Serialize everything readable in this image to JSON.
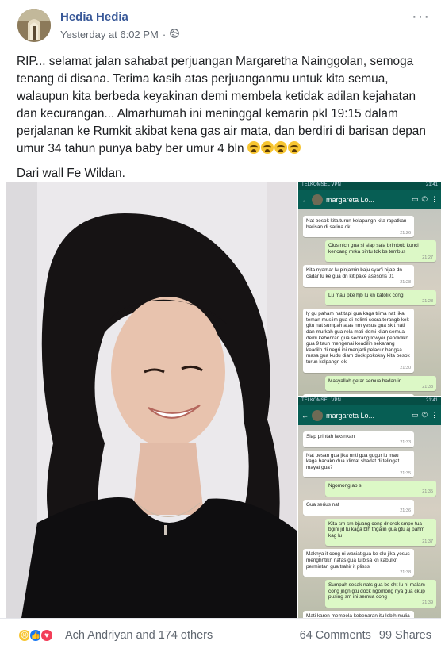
{
  "post": {
    "author": "Hedia Hedia",
    "timestamp": "Yesterday at 6:02 PM",
    "separator": "·",
    "privacy_icon": "globe-icon",
    "more_label": "···",
    "paragraph1": "RIP... selamat jalan sahabat perjuangan Margaretha Nainggolan, semoga tenang di disana. Terima kasih atas perjuanganmu untuk kita semua, walaupun kita berbeda keyakinan demi membela ketidak adilan kejahatan dan kecurangan... Almarhumah ini meninggal kemarin pkl 19:15 dalam perjalanan ke Rumkit akibat kena gas air mata, dan berdiri di barisan depan umur 34 tahun punya baby ber umur 4 bln",
    "emoji_count": 4,
    "paragraph2": "Dari wall Fe Wildan."
  },
  "chat1": {
    "status_left": "TELKOMSEL VPN",
    "status_right": "21:41",
    "contact": "margareta Lo...",
    "messages": [
      {
        "dir": "in",
        "text": "Nat besok kita turun kelapangn kita rapatkan barisan di sarina ok",
        "time": "21:26"
      },
      {
        "dir": "out",
        "text": "Cius nich gua si siap saja brimbob kunci kencang mrka pintu tdk bs tembus",
        "time": "21:27"
      },
      {
        "dir": "in",
        "text": "Kita nyamar lu pinjamin baju syar'i hijab dn cadar lu ke gua dn kit pake asesoris 01",
        "time": "21:28"
      },
      {
        "dir": "out",
        "text": "Lu mau pke hjb lu kn katolik cong",
        "time": "21:28"
      },
      {
        "dir": "in",
        "text": "ly gu paham nat tapi gua kaga trima nat jika teman muslim gua di zolimi secra terangb kek gitu nat sumpah atas nm yesus gua skit hati dan murkah gua rela mati demi klian semua demi kebenran gua seorang lowyer pendidikn gua 9 taun mengenai keadilin sekarang keadiln di negri ini menjadi pelacur bangsa masa gua kudu diam dock pokokny kita besok turun kelpangn ok",
        "time": "21:30"
      },
      {
        "dir": "out",
        "text": "Masyallah getar semua badan in",
        "time": "21:33"
      },
      {
        "dir": "in",
        "text": "Siap printah laksnkan",
        "time": ""
      }
    ]
  },
  "chat2": {
    "status_left": "TELKOMSEL VPN",
    "status_right": "21:41",
    "contact": "margareta Lo...",
    "messages": [
      {
        "dir": "in",
        "text": "Siap printah laksnkan",
        "time": "21:33"
      },
      {
        "dir": "in",
        "text": "Nat pesan gua jika nnti gua gugur lu mau kaga bacakn dua klimat shadat di telingat mayat gua?",
        "time": "21:35"
      },
      {
        "dir": "out",
        "text": "Ngomong ap si",
        "time": "21:35"
      },
      {
        "dir": "in",
        "text": "Gua serius nat",
        "time": "21:36"
      },
      {
        "dir": "out",
        "text": "Kita sm sm bjuang cong dr orok smpe tua bgini jd lu kaga blh tngalin gua gtu aj pahm kag lu",
        "time": "21:37"
      },
      {
        "dir": "in",
        "text": "Maknya it cong ni wasiat gua ke elu jika yesus menghntikn nafas gua lu bisa kn kabulkn permintan gua trahir it plisss",
        "time": "21:38"
      },
      {
        "dir": "out",
        "text": "Sumpah sesak nafs gua bc cht lu ni malam cong jngn gtu dock ngomong nya gua ckup pusing sm ini semua cong",
        "time": "21:39"
      },
      {
        "dir": "in",
        "text": "Mati karen membela kebenaran itu lebih mulia kata orang islam mati shaid jika",
        "time": ""
      }
    ]
  },
  "footer": {
    "reactions": [
      "sad-reaction",
      "like-reaction",
      "love-reaction"
    ],
    "reaction_text": "Ach Andriyan and 174 others",
    "comments": "64 Comments",
    "shares": "99 Shares"
  },
  "colors": {
    "author": "#385898",
    "meta": "#606770",
    "like": "#1877f2",
    "love": "#f33e58",
    "whatsapp_header": "#075e54",
    "bubble_out": "#dcf8c6"
  }
}
